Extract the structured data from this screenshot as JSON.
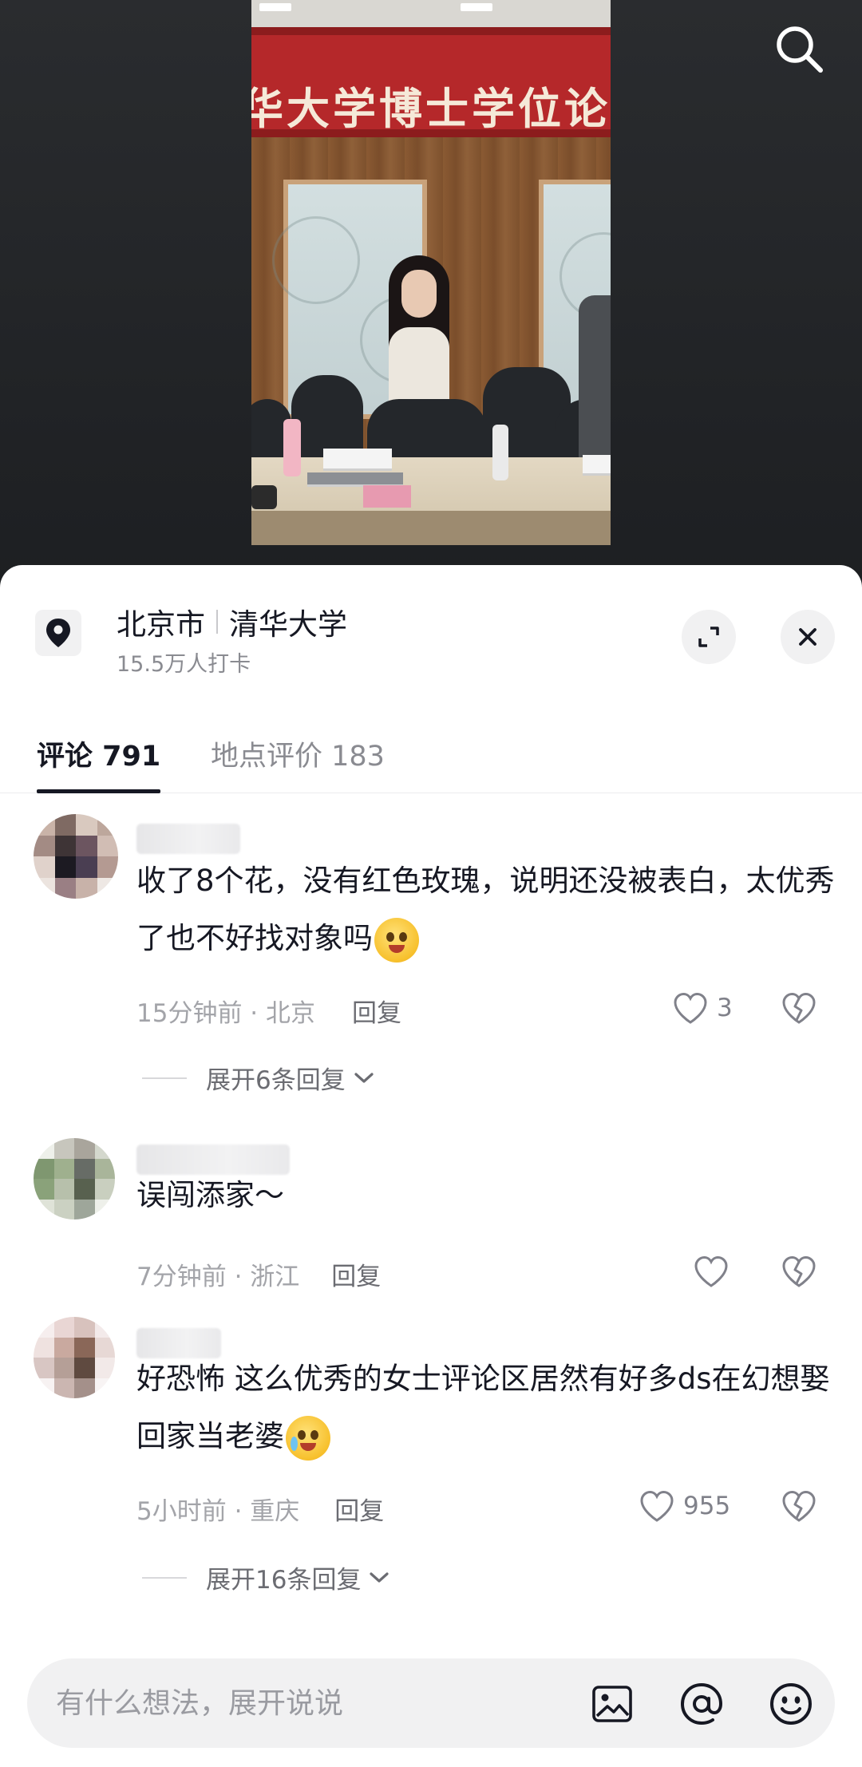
{
  "video": {
    "banner_text": "华大学博士学位论"
  },
  "location": {
    "city": "北京市",
    "place": "清华大学",
    "checkins": "15.5万人打卡"
  },
  "tabs": [
    {
      "label": "评论 791",
      "active": true
    },
    {
      "label": "地点评价 183",
      "active": false
    }
  ],
  "comments": [
    {
      "text": "收了8个花，没有红色玫瑰，说明还没被表白，太优秀了也不好找对象吗",
      "emoji": "pleading-face",
      "time_location": "15分钟前 · 北京",
      "reply_label": "回复",
      "likes": "3",
      "expand_label": "展开6条回复"
    },
    {
      "text": "误闯添家～",
      "time_location": "7分钟前 · 浙江",
      "reply_label": "回复",
      "likes": ""
    },
    {
      "text": "好恐怖 这么优秀的女士评论区居然有好多ds在幻想娶回家当老婆",
      "emoji": "crying-face",
      "time_location": "5小时前 · 重庆",
      "reply_label": "回复",
      "likes": "955",
      "expand_label": "展开16条回复"
    }
  ],
  "composer": {
    "placeholder": "有什么想法，展开说说"
  },
  "colors": {
    "sheet_bg": "#ffffff",
    "text_primary": "#161823",
    "text_secondary": "#8a8b91",
    "banner_red": "#b5282a"
  },
  "icons": [
    "search-icon",
    "location-pin-icon",
    "expand-icon",
    "close-icon",
    "heart-icon",
    "broken-heart-icon",
    "chevron-down-icon",
    "image-icon",
    "at-icon",
    "emoji-icon"
  ]
}
